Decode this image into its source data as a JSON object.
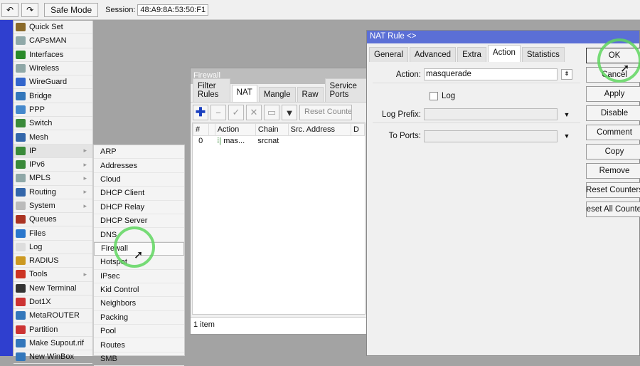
{
  "toolbar": {
    "undo_icon": "undo-icon",
    "redo_icon": "redo-icon",
    "safe_mode": "Safe Mode",
    "session_label": "Session:",
    "session_value": "48:A9:8A:53:50:F1"
  },
  "menu": [
    {
      "label": "Quick Set",
      "color": "#8a6a2a"
    },
    {
      "label": "CAPsMAN",
      "color": "#8fa8a8"
    },
    {
      "label": "Interfaces",
      "color": "#2a8a2a"
    },
    {
      "label": "Wireless",
      "color": "#8fa8a8"
    },
    {
      "label": "WireGuard",
      "color": "#3366cc"
    },
    {
      "label": "Bridge",
      "color": "#3377bb"
    },
    {
      "label": "PPP",
      "color": "#4488cc"
    },
    {
      "label": "Switch",
      "color": "#3a8a3a"
    },
    {
      "label": "Mesh",
      "color": "#3366aa"
    },
    {
      "label": "IP",
      "color": "#3a8a3a",
      "sub": true,
      "active": true
    },
    {
      "label": "IPv6",
      "color": "#3a8a3a",
      "sub": true
    },
    {
      "label": "MPLS",
      "color": "#8fa8a8",
      "sub": true
    },
    {
      "label": "Routing",
      "color": "#3366aa",
      "sub": true
    },
    {
      "label": "System",
      "color": "#bbbbbb",
      "sub": true
    },
    {
      "label": "Queues",
      "color": "#aa3322"
    },
    {
      "label": "Files",
      "color": "#2a77cc"
    },
    {
      "label": "Log",
      "color": "#dddddd"
    },
    {
      "label": "RADIUS",
      "color": "#cc9922"
    },
    {
      "label": "Tools",
      "color": "#cc3322",
      "sub": true
    },
    {
      "label": "New Terminal",
      "color": "#333333"
    },
    {
      "label": "Dot1X",
      "color": "#cc3333"
    },
    {
      "label": "MetaROUTER",
      "color": "#3377bb"
    },
    {
      "label": "Partition",
      "color": "#cc3333"
    },
    {
      "label": "Make Supout.rif",
      "color": "#3377bb"
    },
    {
      "label": "New WinBox",
      "color": "#3377bb"
    }
  ],
  "submenu": [
    "ARP",
    "Addresses",
    "Cloud",
    "DHCP Client",
    "DHCP Relay",
    "DHCP Server",
    "DNS",
    "Firewall",
    "Hotspot",
    "IPsec",
    "Kid Control",
    "Neighbors",
    "Packing",
    "Pool",
    "Routes",
    "SMB"
  ],
  "submenu_highlight": "Firewall",
  "firewall": {
    "title": "Firewall",
    "tabs": [
      "Filter Rules",
      "NAT",
      "Mangle",
      "Raw",
      "Service Ports"
    ],
    "selected_tab": "NAT",
    "reset_counters": "Reset Counters",
    "columns": [
      "#",
      "",
      "Action",
      "Chain",
      "Src. Address",
      "D"
    ],
    "rows": [
      {
        "num": "0",
        "action": "mas...",
        "chain": "srcnat"
      }
    ],
    "status": "1 item"
  },
  "nat_rule": {
    "title": "NAT Rule <>",
    "tabs": [
      "General",
      "Advanced",
      "Extra",
      "Action",
      "Statistics"
    ],
    "selected_tab": "Action",
    "action_label": "Action:",
    "action_value": "masquerade",
    "log_label": "Log",
    "log_checked": false,
    "log_prefix_label": "Log Prefix:",
    "log_prefix_value": "",
    "to_ports_label": "To Ports:",
    "to_ports_value": "",
    "buttons": [
      "OK",
      "Cancel",
      "Apply",
      "Disable",
      "Comment",
      "Copy",
      "Remove",
      "Reset Counters",
      "Reset All Counters"
    ]
  },
  "annotation_colors": {
    "highlight_circle": "#5fd65f",
    "title_bar": "#5b6fd6"
  }
}
